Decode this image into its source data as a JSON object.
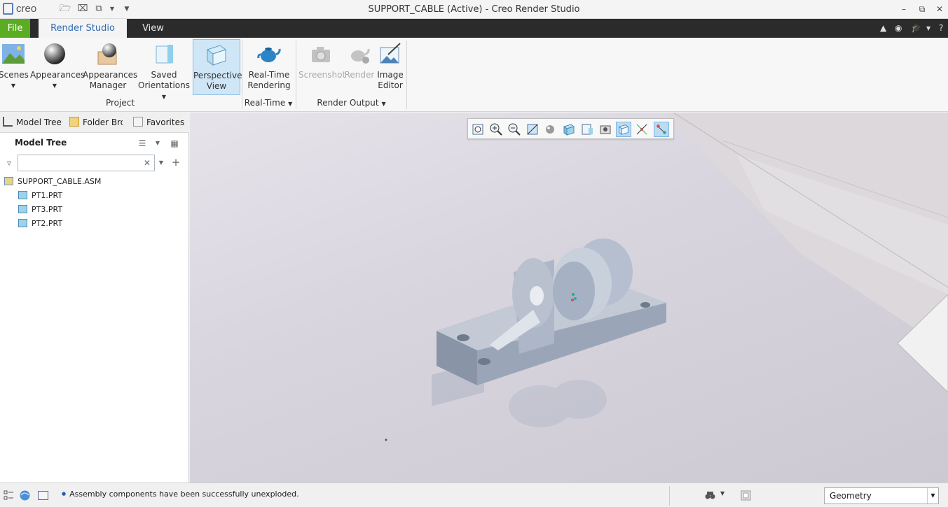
{
  "window": {
    "title": "SUPPORT_CABLE (Active) - Creo Render Studio",
    "logo_text": "creo"
  },
  "tabs": [
    {
      "label": "File"
    },
    {
      "label": "Render Studio"
    },
    {
      "label": "View"
    }
  ],
  "ribbon": {
    "scenes": "Scenes",
    "appearances": "Appearances",
    "appearances_manager_1": "Appearances",
    "appearances_manager_2": "Manager",
    "saved_orientations_1": "Saved",
    "saved_orientations_2": "Orientations",
    "perspective_view_1": "Perspective",
    "perspective_view_2": "View",
    "realtime_rendering_1": "Real-Time",
    "realtime_rendering_2": "Rendering",
    "screenshot": "Screenshot",
    "render": "Render",
    "image_editor_1": "Image",
    "image_editor_2": "Editor",
    "group_project": "Project",
    "group_realtime": "Real-Time",
    "group_render_output": "Render Output"
  },
  "nav_tabs": [
    {
      "label": "Model Tree"
    },
    {
      "label": "Folder Browser"
    },
    {
      "label": "Favorites"
    }
  ],
  "model_tree": {
    "title": "Model Tree",
    "filter_value": "",
    "items": [
      {
        "label": "SUPPORT_CABLE.ASM"
      },
      {
        "label": "PT1.PRT"
      },
      {
        "label": "PT3.PRT"
      },
      {
        "label": "PT2.PRT"
      }
    ]
  },
  "status": {
    "message": "Assembly components have been successfully unexploded.",
    "selection_filter": "Geometry"
  },
  "colors": {
    "file_tab": "#5aac22",
    "tab_bar": "#2b2b2b",
    "active_tab_text": "#2f6bb0",
    "model_color": "#a9b4c6"
  }
}
